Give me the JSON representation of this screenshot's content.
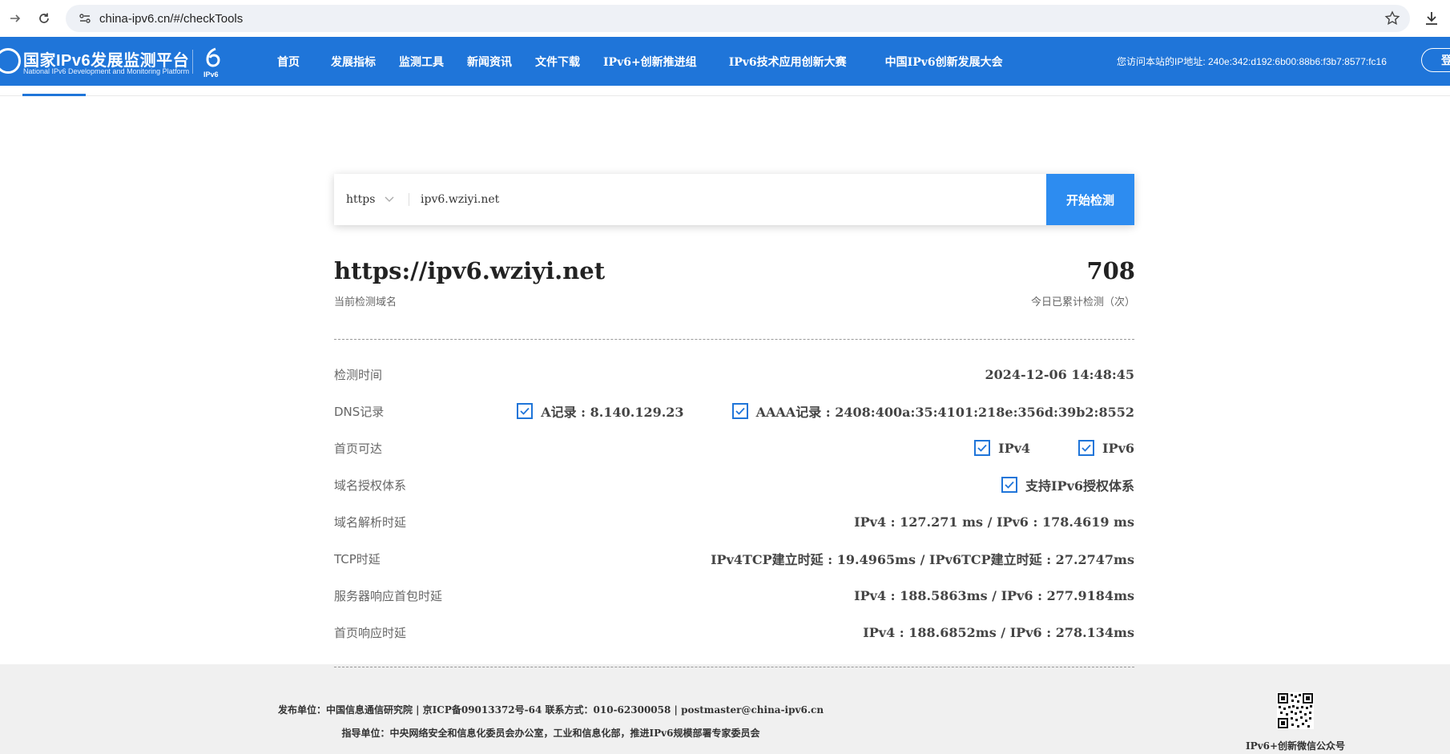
{
  "browser": {
    "url": "china-ipv6.cn/#/checkTools"
  },
  "header": {
    "logo_title": "国家IPv6发展监测平台",
    "logo_subtitle": "National IPv6 Development and Monitoring Platform",
    "ipv6_mark": "IPv6",
    "menu": [
      "首页",
      "发展指标",
      "监测工具",
      "新闻资讯",
      "文件下载",
      "IPv6+创新推进组",
      "IPv6技术应用创新大赛",
      "中国IPv6创新发展大会"
    ],
    "ip_info": "您访问本站的IP地址: 240e:342:d192:6b00:88b6:f3b7:8577:fc16",
    "login_label": "登"
  },
  "search": {
    "protocol": "https",
    "domain": "ipv6.wziyi.net",
    "start_label": "开始检测"
  },
  "result": {
    "domain": "https://ipv6.wziyi.net",
    "domain_label": "当前检测域名",
    "count": "708",
    "count_label": "今日已累计检测（次）",
    "rows": {
      "check_time": {
        "label": "检测时间",
        "value": "2024-12-06 14:48:45"
      },
      "dns": {
        "label": "DNS记录",
        "a_record": "A记录 : 8.140.129.23",
        "aaaa_record": "AAAA记录 : 2408:400a:35:4101:218e:356d:39b2:8552"
      },
      "reachable": {
        "label": "首页可达",
        "ipv4": "IPv4",
        "ipv6": "IPv6"
      },
      "auth": {
        "label": "域名授权体系",
        "value": "支持IPv6授权体系"
      },
      "resolve": {
        "label": "域名解析时延",
        "value": "IPv4 : 127.271 ms / IPv6 : 178.4619 ms"
      },
      "tcp": {
        "label": "TCP时延",
        "value": "IPv4TCP建立时延 : 19.4965ms / IPv6TCP建立时延 : 27.2747ms"
      },
      "first_packet": {
        "label": "服务器响应首包时延",
        "value": "IPv4 : 188.5863ms / IPv6 : 277.9184ms"
      },
      "page_response": {
        "label": "首页响应时延",
        "value": "IPv4 : 188.6852ms / IPv6 : 278.134ms"
      }
    }
  },
  "footer": {
    "line1": "发布单位：中国信息通信研究院 | 京ICP备09013372号-64 联系方式：010-62300058 | postmaster@china-ipv6.cn",
    "line2": "指导单位：中央网络安全和信息化委员会办公室，工业和信息化部，推进IPv6规模部署专家委员会",
    "qr_label": "IPv6+创新微信公众号"
  },
  "colors": {
    "brand": "#1f75d9",
    "button": "#2d8cf0"
  }
}
